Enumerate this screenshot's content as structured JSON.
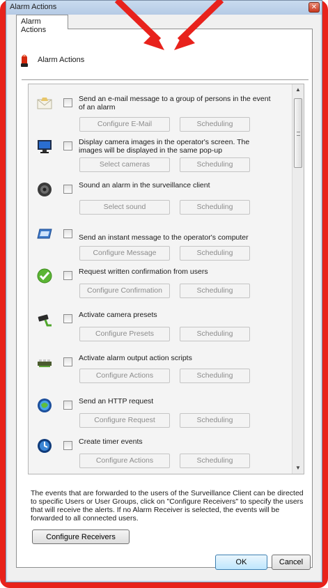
{
  "window": {
    "title": "Alarm Actions",
    "close_glyph": "✕"
  },
  "tab": {
    "label": "Alarm Actions"
  },
  "header": {
    "title": "Alarm Actions",
    "icon": "alarm-light-icon"
  },
  "scrollbar": {
    "up_glyph": "▲",
    "down_glyph": "▼"
  },
  "actions": [
    {
      "icon": "email-envelope-icon",
      "text": "Send an e-mail message to a group of persons in the event of an alarm",
      "configure_label": "Configure E-Mail",
      "scheduling_label": "Scheduling",
      "checked": false
    },
    {
      "icon": "monitor-icon",
      "text": "Display camera images in the operator's screen. The images will be displayed in the same pop-up",
      "configure_label": "Select cameras",
      "scheduling_label": "Scheduling",
      "checked": false
    },
    {
      "icon": "speaker-icon",
      "text": "Sound an alarm in the surveillance client",
      "configure_label": "Select sound",
      "scheduling_label": "Scheduling",
      "checked": false
    },
    {
      "icon": "instant-message-icon",
      "text": "Send an instant message to the operator's computer",
      "configure_label": "Configure Message",
      "scheduling_label": "Scheduling",
      "checked": false
    },
    {
      "icon": "checkmark-icon",
      "text": "Request written confirmation from users",
      "configure_label": "Configure Confirmation",
      "scheduling_label": "Scheduling",
      "checked": false
    },
    {
      "icon": "ptz-camera-icon",
      "text": "Activate camera presets",
      "configure_label": "Configure Presets",
      "scheduling_label": "Scheduling",
      "checked": false
    },
    {
      "icon": "output-relay-icon",
      "text": "Activate alarm output action scripts",
      "configure_label": "Configure Actions",
      "scheduling_label": "Scheduling",
      "checked": false
    },
    {
      "icon": "http-globe-icon",
      "text": "Send an HTTP request",
      "configure_label": "Configure Request",
      "scheduling_label": "Scheduling",
      "checked": false
    },
    {
      "icon": "timer-globe-icon",
      "text": "Create timer events",
      "configure_label": "Configure Actions",
      "scheduling_label": "Scheduling",
      "checked": false
    }
  ],
  "footer": {
    "text": "The events that are forwarded to the users of the Surveillance Client can be directed to specific Users or User Groups, click on \"Configure Receivers\" to specify the users that will receive the alerts. If no Alarm Receiver is selected, the events will be forwarded to all connected users.",
    "configure_receivers_label": "Configure Receivers"
  },
  "buttons": {
    "ok_label": "OK",
    "cancel_label": "Cancel"
  },
  "colors": {
    "annotation_red": "#e8221c",
    "titlebar": "#c9dbef",
    "panel": "#ffffff",
    "disabled_text": "#8c8c8c"
  }
}
